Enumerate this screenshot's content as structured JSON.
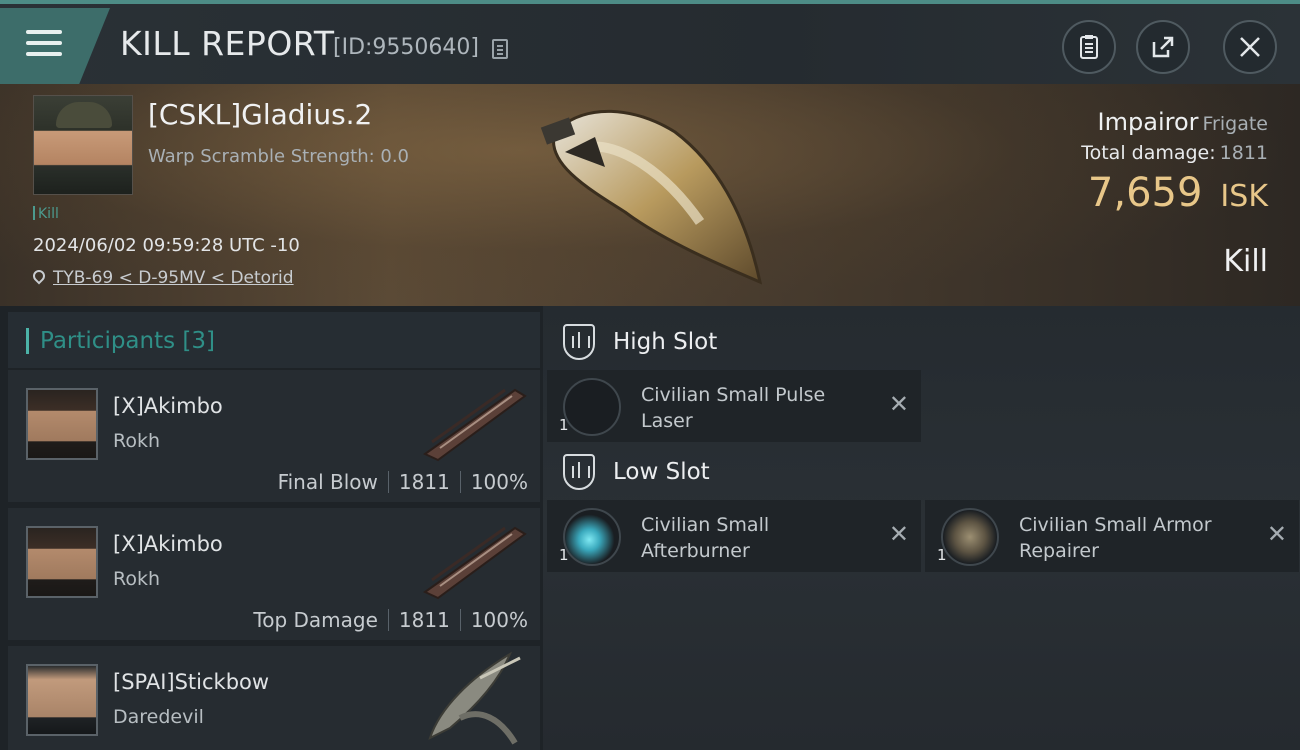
{
  "header": {
    "title": "KILL REPORT",
    "report_id": "[ID:9550640]"
  },
  "victim": {
    "name": "[CSKL]Gladius.2",
    "warp_scramble": "Warp Scramble Strength: 0.0",
    "kill_tag": "Kill",
    "datetime": "2024/06/02 09:59:28 UTC -10",
    "location": "TYB-69 < D-95MV < Detorid",
    "ship_name": "Impairor",
    "ship_class": "Frigate",
    "total_damage_label": "Total damage:",
    "total_damage_value": "1811",
    "isk_value": "7,659",
    "isk_unit": "ISK",
    "result": "Kill"
  },
  "participants": {
    "title": "Participants",
    "count": "[3]",
    "rows": [
      {
        "name": "[X]Akimbo",
        "ship": "Rokh",
        "role": "Final Blow",
        "damage": "1811",
        "percent": "100%"
      },
      {
        "name": "[X]Akimbo",
        "ship": "Rokh",
        "role": "Top Damage",
        "damage": "1811",
        "percent": "100%"
      },
      {
        "name": "[SPAI]Stickbow",
        "ship": "Daredevil"
      }
    ]
  },
  "fitting": {
    "high_slot_title": "High Slot",
    "low_slot_title": "Low Slot",
    "high_modules": [
      {
        "name": "Civilian Small Pulse Laser",
        "qty": "1"
      }
    ],
    "low_modules": [
      {
        "name": "Civilian Small Afterburner",
        "qty": "1"
      },
      {
        "name": "Civilian Small Armor Repairer",
        "qty": "1"
      }
    ]
  },
  "icons": {
    "menu": "menu-icon",
    "copy": "copy-icon",
    "clipboard": "clipboard-icon",
    "share": "share-icon",
    "close": "close-icon",
    "location": "location-pin-icon",
    "slot": "slot-shield-icon",
    "remove": "remove-icon"
  },
  "colors": {
    "accent": "#4d8c86",
    "isk": "#e8c789",
    "participants_title": "#2f8f87"
  }
}
